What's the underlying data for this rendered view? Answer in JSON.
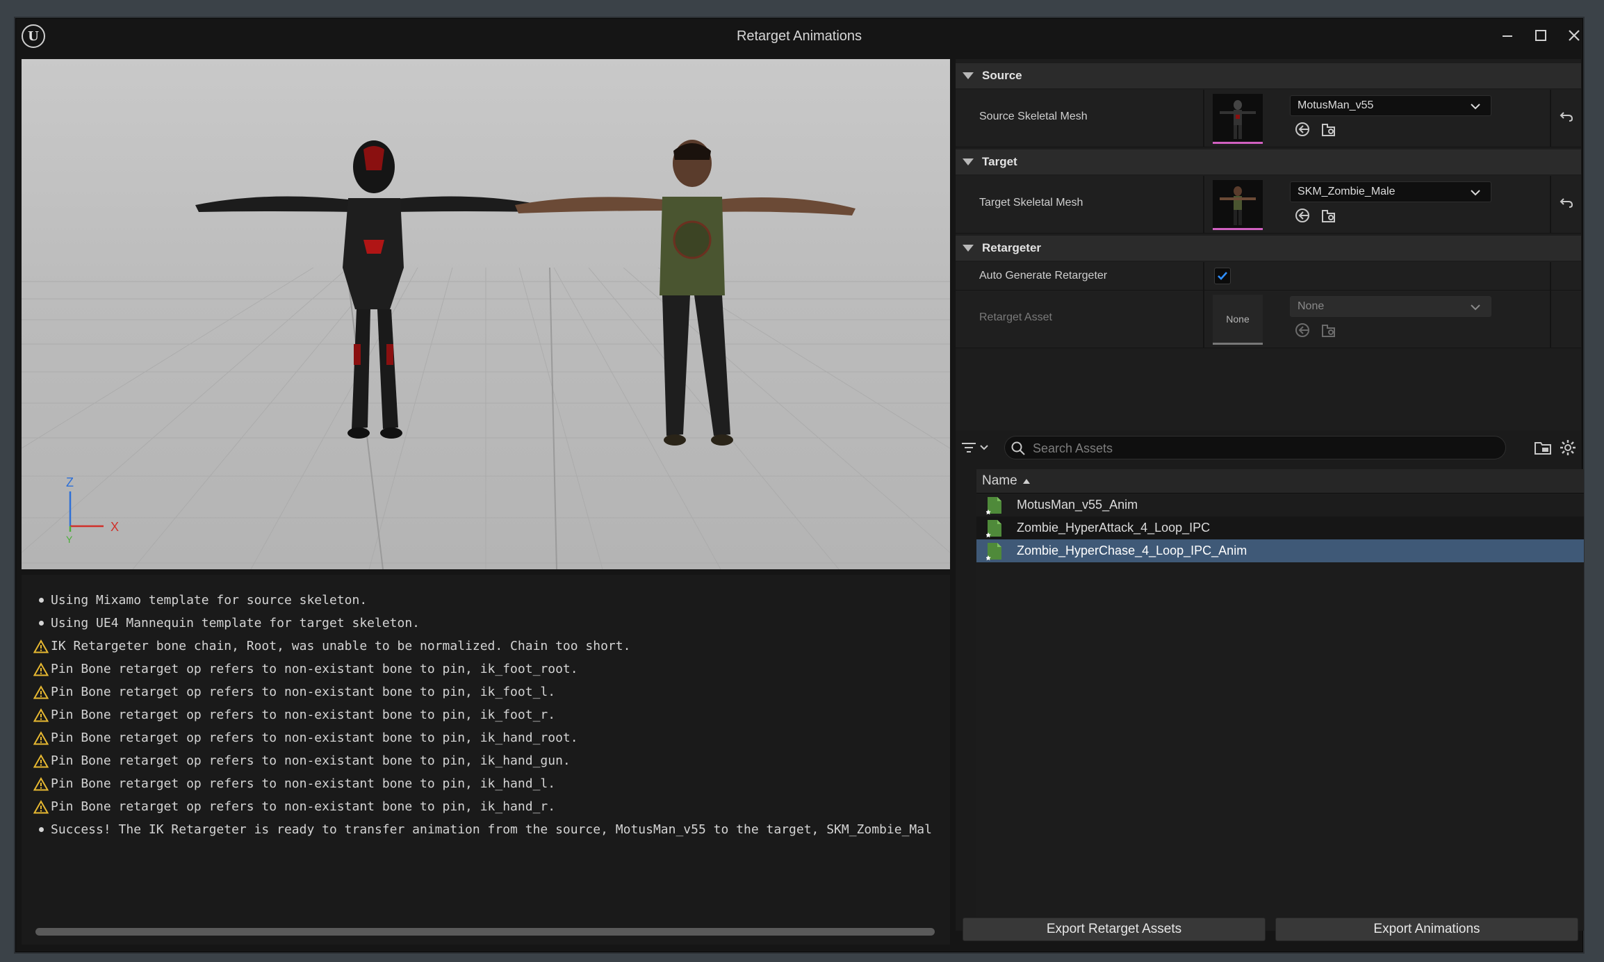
{
  "window": {
    "title": "Retarget Animations",
    "logo_icon": "unreal-engine-logo-icon",
    "controls": [
      "minimize-icon",
      "maximize-icon",
      "close-icon"
    ]
  },
  "viewport": {
    "axis_labels": {
      "z": "Z",
      "x": "X",
      "y": "Y"
    },
    "colors": {
      "z": "#2d6fd6",
      "x": "#d0302a",
      "y": "#4caf3a"
    }
  },
  "log": {
    "lines": [
      {
        "type": "info",
        "text": "Using Mixamo template for source skeleton."
      },
      {
        "type": "info",
        "text": "Using UE4 Mannequin template for target skeleton."
      },
      {
        "type": "warning",
        "text": "IK Retargeter bone chain, Root, was unable to be normalized. Chain too short."
      },
      {
        "type": "warning",
        "text": "Pin Bone retarget op refers to non-existant bone to pin, ik_foot_root."
      },
      {
        "type": "warning",
        "text": "Pin Bone retarget op refers to non-existant bone to pin, ik_foot_l."
      },
      {
        "type": "warning",
        "text": "Pin Bone retarget op refers to non-existant bone to pin, ik_foot_r."
      },
      {
        "type": "warning",
        "text": "Pin Bone retarget op refers to non-existant bone to pin, ik_hand_root."
      },
      {
        "type": "warning",
        "text": "Pin Bone retarget op refers to non-existant bone to pin, ik_hand_gun."
      },
      {
        "type": "warning",
        "text": "Pin Bone retarget op refers to non-existant bone to pin, ik_hand_l."
      },
      {
        "type": "warning",
        "text": "Pin Bone retarget op refers to non-existant bone to pin, ik_hand_r."
      },
      {
        "type": "info",
        "text": "Success! The IK Retargeter is ready to transfer animation from the source, MotusMan_v55 to the target, SKM_Zombie_Mal"
      }
    ],
    "warning_color": "#e8b931"
  },
  "details": {
    "source": {
      "category": "Source",
      "label": "Source Skeletal Mesh",
      "value": "MotusMan_v55"
    },
    "target": {
      "category": "Target",
      "label": "Target Skeletal Mesh",
      "value": "SKM_Zombie_Male"
    },
    "retargeter": {
      "category": "Retargeter",
      "auto_label": "Auto Generate Retargeter",
      "auto_checked": true,
      "asset_label": "Retarget Asset",
      "asset_thumb": "None",
      "asset_value": "None"
    }
  },
  "picker": {
    "search_placeholder": "Search Assets",
    "column_name": "Name",
    "assets": [
      {
        "name": "MotusMan_v55_Anim",
        "selected": false
      },
      {
        "name": "Zombie_HyperAttack_4_Loop_IPC",
        "selected": false
      },
      {
        "name": "Zombie_HyperChase_4_Loop_IPC_Anim",
        "selected": true
      }
    ]
  },
  "buttons": {
    "export_retarget": "Export Retarget Assets",
    "export_animations": "Export Animations"
  },
  "colors": {
    "selection": "#3f5977",
    "checkbox_check": "#2f8fff",
    "thumb_underline": "#d060c0"
  }
}
